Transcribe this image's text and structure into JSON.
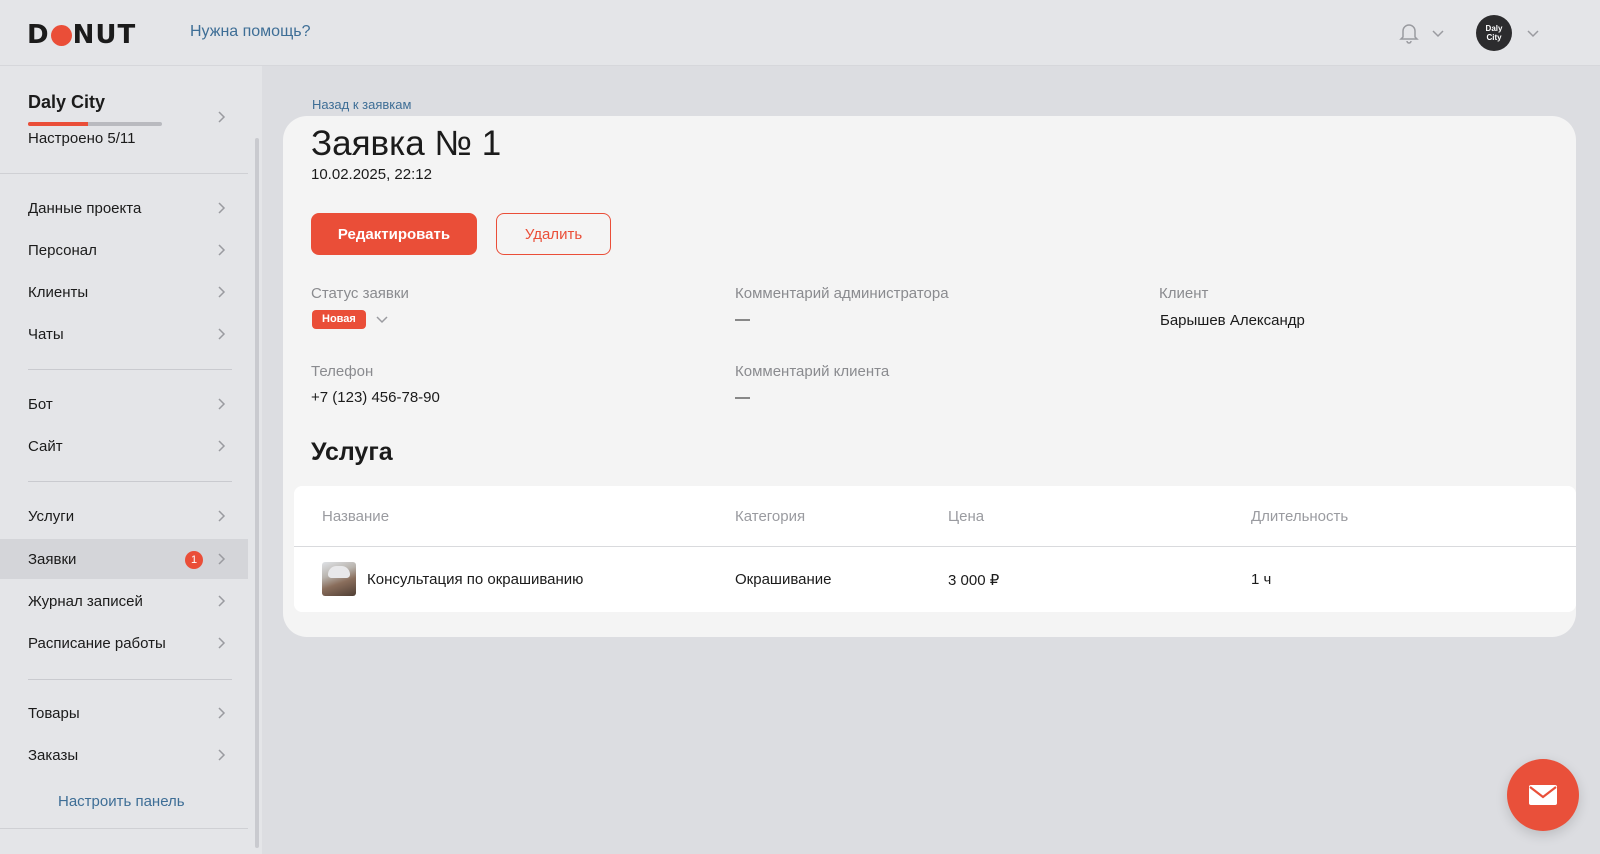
{
  "header": {
    "logo_prefix": "D",
    "logo_suffix": "NUT",
    "help_link": "Нужна помощь?",
    "avatar_line1": "Daly",
    "avatar_line2": "City"
  },
  "sidebar": {
    "project": {
      "name": "Daly City",
      "status": "Настроено 5/11",
      "progress": 0.45
    },
    "items": [
      {
        "label": "Данные проекта"
      },
      {
        "label": "Персонал"
      },
      {
        "label": "Клиенты"
      },
      {
        "label": "Чаты"
      },
      {
        "label": "Бот"
      },
      {
        "label": "Сайт"
      },
      {
        "label": "Услуги"
      },
      {
        "label": "Заявки",
        "badge": "1"
      },
      {
        "label": "Журнал записей"
      },
      {
        "label": "Расписание работы"
      },
      {
        "label": "Товары"
      },
      {
        "label": "Заказы"
      }
    ],
    "customize": "Настроить панель"
  },
  "main": {
    "back_link": "Назад к заявкам",
    "title": "Заявка № 1",
    "date": "10.02.2025, 22:12",
    "edit_button": "Редактировать",
    "delete_button": "Удалить",
    "fields": {
      "status_label": "Статус заявки",
      "status_value": "Новая",
      "admin_comment_label": "Комментарий администратора",
      "admin_comment_value": "—",
      "client_label": "Клиент",
      "client_value": "Барышев Александр",
      "phone_label": "Телефон",
      "phone_value": "+7 (123) 456-78-90",
      "client_comment_label": "Комментарий клиента",
      "client_comment_value": "—"
    },
    "service_section": "Услуга",
    "table": {
      "headers": [
        "Название",
        "Категория",
        "Цена",
        "Длительность"
      ],
      "rows": [
        {
          "name": "Консультация по окрашиванию",
          "category": "Окрашивание",
          "price": "3 000 ₽",
          "duration": "1 ч"
        }
      ]
    }
  },
  "colors": {
    "accent": "#ea4e38",
    "link": "#3e6e96"
  }
}
